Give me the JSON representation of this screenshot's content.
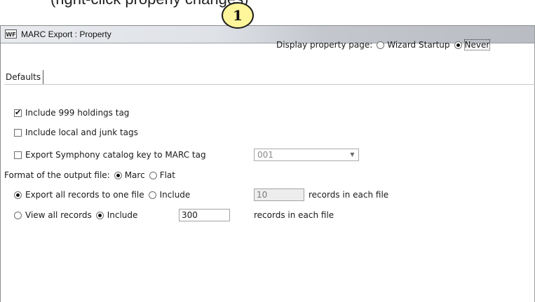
{
  "caption": {
    "text": "(right-click properly changes)"
  },
  "callout": {
    "number": "1"
  },
  "window": {
    "icon_text": "WF",
    "title": "MARC Export : Property"
  },
  "display": {
    "label": "Display property page:",
    "opt1": "Wizard Startup",
    "opt2": "Never",
    "selected": "Never"
  },
  "tabs": {
    "defaults": "Defaults"
  },
  "options": {
    "include_999": {
      "label": "Include 999 holdings tag",
      "checked": true
    },
    "include_local": {
      "label": "Include local and junk tags",
      "checked": false
    },
    "export_key": {
      "label": "Export Symphony catalog key to MARC tag",
      "checked": false,
      "tag_value": "001"
    }
  },
  "format": {
    "label": "Format of the output file:",
    "opt1": "Marc",
    "opt2": "Flat",
    "selected": "Marc"
  },
  "export_records": {
    "opt1": "Export all records to one file",
    "opt2": "Include",
    "count": "10",
    "suffix": "records in each file",
    "selected": "Export all records to one file"
  },
  "view_records": {
    "opt1": "View all records",
    "opt2": "Include",
    "count": "300",
    "suffix": "records in each file",
    "selected": "Include"
  }
}
